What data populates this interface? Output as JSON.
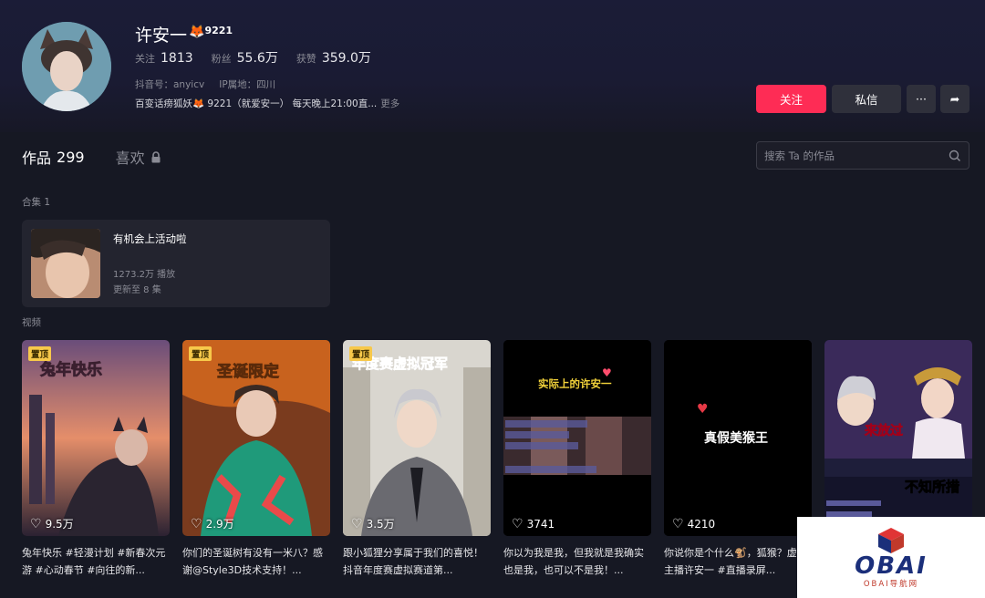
{
  "profile": {
    "name": "许安一",
    "name_emoji": "🦊",
    "name_number": "9221",
    "stats": [
      {
        "label": "关注",
        "value": "1813"
      },
      {
        "label": "粉丝",
        "value": "55.6万"
      },
      {
        "label": "获赞",
        "value": "359.0万"
      }
    ],
    "douyin_id": "抖音号：anyicv",
    "ip_location": "IP属地：四川",
    "bio": "百变话痨狐妖🦊 9221（就爱安一） 每天晚上21:00直...",
    "bio_more": "更多"
  },
  "actions": {
    "follow": "关注",
    "message": "私信",
    "more": "···",
    "share": "➦"
  },
  "tabs": {
    "works_label": "作品",
    "works_count": "299",
    "likes_label": "喜欢"
  },
  "search": {
    "placeholder": "搜索 Ta 的作品"
  },
  "collection_section": {
    "label": "合集 1",
    "title": "有机会上活动啦",
    "plays": "1273.2万 播放",
    "updates": "更新至 8 集"
  },
  "videos_section": {
    "label": "视频",
    "items": [
      {
        "pinned": "置顶",
        "overlay": "兔年快乐",
        "likes": "9.5万",
        "desc": "兔年快乐 #轻漫计划 #新春次元游 #心动春节 #向往的新..."
      },
      {
        "pinned": "置顶",
        "overlay": "圣诞限定",
        "likes": "2.9万",
        "desc": "你们的圣诞树有没有一米八？感谢@Style3D技术支持！..."
      },
      {
        "pinned": "置顶",
        "overlay": "年度赛虚拟冠军",
        "likes": "3.5万",
        "desc": "跟小狐狸分享属于我们的喜悦！抖音年度赛虚拟赛道第..."
      },
      {
        "pinned": "",
        "overlay": "实际上的许安一",
        "likes": "3741",
        "desc": "你以为我是我，但我就是我确实也是我，也可以不是我！..."
      },
      {
        "pinned": "",
        "overlay": "真假美猴王",
        "likes": "4210",
        "desc": "你说你是个什么🐒，狐猴？虚拟主播许安一 #直播录屏..."
      },
      {
        "pinned": "",
        "overlay": "不知所措",
        "likes": "",
        "desc": ""
      }
    ]
  },
  "watermark": {
    "text": "OBAI",
    "sub": "OBAI导航网"
  }
}
